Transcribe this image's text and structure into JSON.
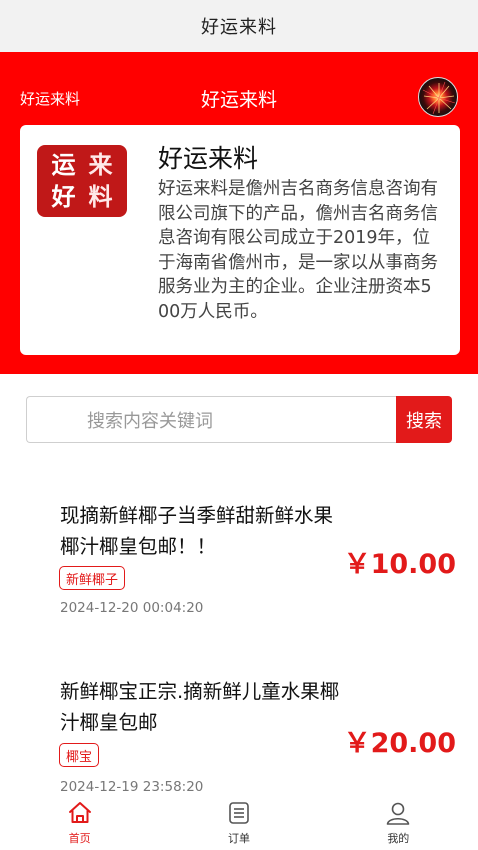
{
  "window": {
    "title": "好运来料"
  },
  "header": {
    "left_title": "好运来料",
    "center_title": "好运来料"
  },
  "company": {
    "logo_chars": [
      "运",
      "来",
      "好",
      "料"
    ],
    "name": "好运来料",
    "description": "好运来料是儋州吉名商务信息咨询有限公司旗下的产品，儋州吉名商务信息咨询有限公司成立于2019年，位于海南省儋州市，是一家以从事商务服务业为主的企业。企业注册资本500万人民币。"
  },
  "search": {
    "placeholder": "搜索内容关键词",
    "button_label": "搜索"
  },
  "products": [
    {
      "title": "现摘新鲜椰子当季鲜甜新鲜水果椰汁椰皇包邮！！",
      "tag": "新鲜椰子",
      "time": "2024-12-20 00:04:20",
      "price": "￥10.00"
    },
    {
      "title": "新鲜椰宝正宗.摘新鲜儿童水果椰汁椰皇包邮",
      "tag": "椰宝",
      "time": "2024-12-19 23:58:20",
      "price": "￥20.00"
    }
  ],
  "tabbar": {
    "tabs": [
      {
        "label": "首页",
        "icon": "home-icon",
        "active": true
      },
      {
        "label": "订单",
        "icon": "order-list-icon",
        "active": false
      },
      {
        "label": "我的",
        "icon": "user-icon",
        "active": false
      }
    ]
  },
  "colors": {
    "accent": "#e21a1a",
    "hero_bg": "#ff0000"
  }
}
